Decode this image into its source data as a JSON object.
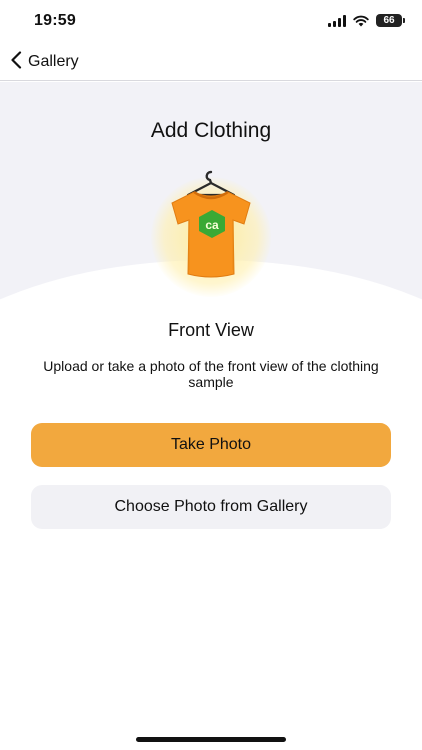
{
  "status_bar": {
    "time": "19:59",
    "battery_level": "66",
    "icons": [
      "signal-icon",
      "wifi-icon",
      "battery-icon"
    ]
  },
  "nav": {
    "back_label": "Gallery",
    "back_icon": "chevron-left-icon"
  },
  "page": {
    "title": "Add Clothing",
    "illustration": "tshirt-on-hanger",
    "illustration_badge_text": "CA"
  },
  "step": {
    "title": "Front View",
    "instructions": "Upload or take a photo of the front view of the clothing sample"
  },
  "actions": {
    "take_photo_label": "Take Photo",
    "choose_gallery_label": "Choose Photo from Gallery"
  },
  "colors": {
    "accent": "#f2a83e",
    "secondary_button": "#f1f1f5",
    "hero_background": "#f2f2f7",
    "shirt": "#f7931e",
    "badge": "#3aa935"
  }
}
